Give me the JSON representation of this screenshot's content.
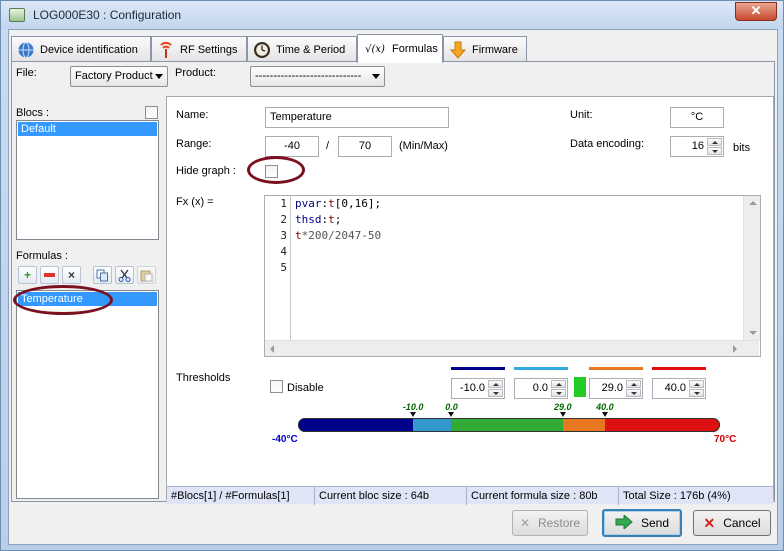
{
  "window": {
    "title": "LOG000E30 : Configuration",
    "close_glyph": "✕"
  },
  "tabs": [
    {
      "label": "Device identification",
      "icon": "globe-icon"
    },
    {
      "label": "RF Settings",
      "icon": "antenna-icon"
    },
    {
      "label": "Time & Period",
      "icon": "clock-icon"
    },
    {
      "label": "Formulas",
      "icon": "sqrt-fx-icon",
      "active": true,
      "icon_text": "√(x)"
    },
    {
      "label": "Firmware",
      "icon": "download-arrow-icon"
    }
  ],
  "file": {
    "label": "File:",
    "value": "Factory Product"
  },
  "product": {
    "label": "Product:",
    "value": "-----------------------------"
  },
  "blocs": {
    "label": "Blocs :",
    "items": [
      "Default"
    ]
  },
  "formulas": {
    "label": "Formulas :",
    "items": [
      "Temperature"
    ]
  },
  "form": {
    "name_label": "Name:",
    "name_value": "Temperature",
    "unit_label": "Unit:",
    "unit_value": "°C",
    "range_label": "Range:",
    "range_min": "-40",
    "range_sep": "/",
    "range_max": "70",
    "range_hint": "(Min/Max)",
    "encoding_label": "Data encoding:",
    "encoding_value": "16",
    "encoding_unit": "bits",
    "hide_graph_label": "Hide graph :",
    "fx_label": "Fx (x) ="
  },
  "code_lines": [
    "1",
    "2",
    "3",
    "4",
    "5"
  ],
  "code": {
    "l1a": "pvar",
    "l1b": ":",
    "l1c": "t",
    "l1d": "[0,16];",
    "l2a": "thsd",
    "l2b": ":",
    "l2c": "t",
    "l2d": ";",
    "l3a": "t",
    "l3b": "*200/2047-50"
  },
  "thresholds": {
    "label": "Thresholds",
    "disable_label": "Disable",
    "values": [
      "-10.0",
      "0.0",
      "29.0",
      "40.0"
    ],
    "line_colors": [
      "#00008b",
      "#33aadd",
      "#e87722",
      "#dd1111"
    ],
    "mid_marker_color": "#22cc22",
    "scale_min": "-40°C",
    "scale_max": "70°C",
    "scale_min_value": -40,
    "scale_max_value": 70,
    "tick_labels": [
      "-10.0",
      "0.0",
      "29.0",
      "40.0"
    ],
    "tick_values": [
      -10,
      0,
      29,
      40
    ],
    "segment_colors": [
      "#00008b",
      "#3399cc",
      "#33aa33",
      "#e87722",
      "#dd1111"
    ],
    "min_label_color": "#0000cc",
    "max_label_color": "#cc0000",
    "tick_label_color": "#006600"
  },
  "status": {
    "blocs": "#Blocs[1] / #Formulas[1]",
    "bloc_size": "Current bloc size : 64b",
    "formula_size": "Current formula size : 80b",
    "total_size": "Total Size : 176b (4%)"
  },
  "buttons": {
    "restore": "Restore",
    "send": "Send",
    "cancel": "Cancel"
  },
  "annotation_color": "#7b1020"
}
